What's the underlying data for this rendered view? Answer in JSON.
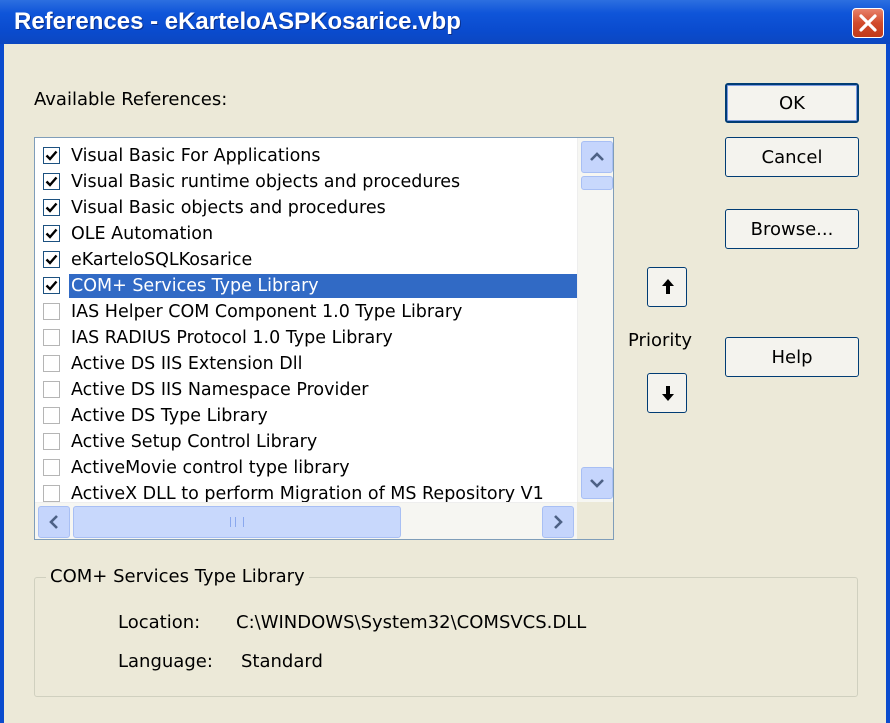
{
  "window": {
    "title": "References - eKarteloASPKosarice.vbp",
    "close_icon": "close-icon"
  },
  "available_label": "Available References:",
  "buttons": {
    "ok": "OK",
    "cancel": "Cancel",
    "browse": "Browse...",
    "help": "Help"
  },
  "priority_label": "Priority",
  "references": [
    {
      "label": "Visual Basic For Applications",
      "checked": true
    },
    {
      "label": "Visual Basic runtime objects and procedures",
      "checked": true
    },
    {
      "label": "Visual Basic objects and procedures",
      "checked": true
    },
    {
      "label": "OLE Automation",
      "checked": true
    },
    {
      "label": "eKarteloSQLKosarice",
      "checked": true
    },
    {
      "label": "COM+ Services Type Library",
      "checked": true,
      "selected": true
    },
    {
      "label": " IAS Helper COM Component 1.0 Type Library",
      "checked": false
    },
    {
      "label": " IAS RADIUS Protocol 1.0 Type Library",
      "checked": false
    },
    {
      "label": "Active DS IIS Extension Dll",
      "checked": false
    },
    {
      "label": "Active DS IIS Namespace Provider",
      "checked": false
    },
    {
      "label": "Active DS Type Library",
      "checked": false
    },
    {
      "label": "Active Setup Control Library",
      "checked": false
    },
    {
      "label": "ActiveMovie control type library",
      "checked": false
    },
    {
      "label": "ActiveX DLL to perform Migration of MS Repository V1",
      "checked": false
    }
  ],
  "details": {
    "title": "COM+ Services Type Library",
    "location_label": "Location:",
    "location_value": "C:\\WINDOWS\\System32\\COMSVCS.DLL",
    "language_label": "Language:",
    "language_value": "Standard"
  }
}
